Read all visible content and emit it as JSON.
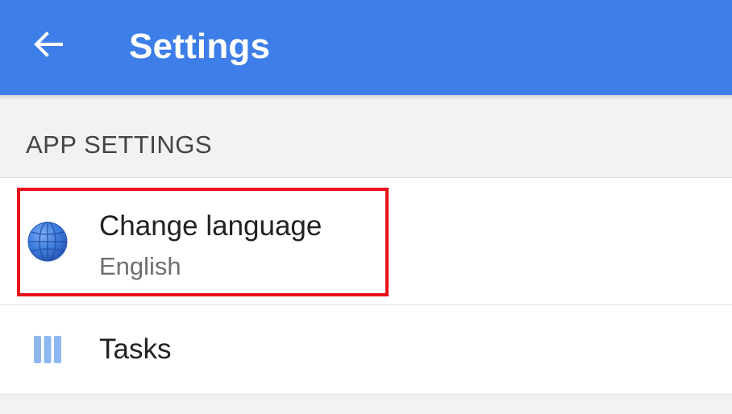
{
  "appbar": {
    "title": "Settings",
    "back_icon": "arrow-left-icon",
    "background_color": "#3e7ee9"
  },
  "section": {
    "header": "APP SETTINGS"
  },
  "items": [
    {
      "title": "Change language",
      "subtitle": "English",
      "icon": "globe-icon"
    },
    {
      "title": "Tasks",
      "icon": "columns-icon"
    }
  ],
  "highlight": {
    "color": "#e8101a",
    "target": "Change language"
  }
}
